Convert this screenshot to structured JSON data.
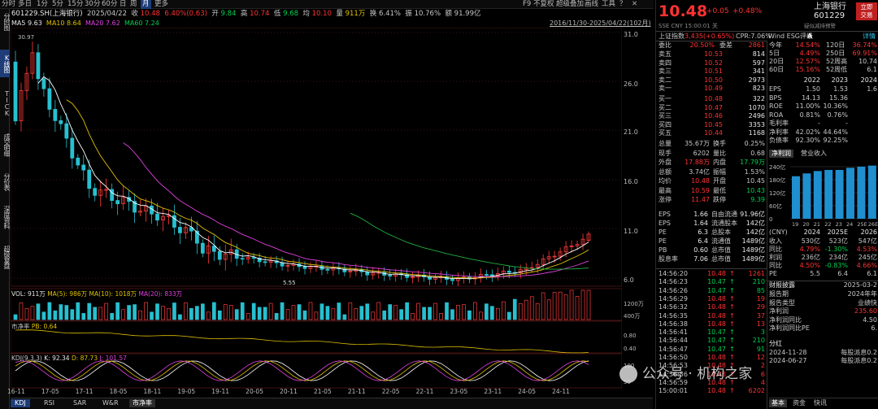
{
  "top_menu": [
    {
      "label": "分时"
    },
    {
      "label": "多日"
    },
    {
      "label": "1分"
    },
    {
      "label": "5分"
    },
    {
      "label": "15分"
    },
    {
      "label": "30分"
    },
    {
      "label": "60分"
    },
    {
      "label": "日"
    },
    {
      "label": "周"
    },
    {
      "label": "月",
      "active": true
    },
    {
      "label": "更多"
    }
  ],
  "top_right_menu": [
    "F9",
    "不复权",
    "超级叠加",
    "画线",
    "工具",
    "？"
  ],
  "side_tabs": [
    {
      "label": "分时图"
    },
    {
      "label": "K线图",
      "active": true
    },
    {
      "label": "TICK"
    },
    {
      "label": "成交明细"
    },
    {
      "label": "分价表"
    },
    {
      "label": "深度资料"
    },
    {
      "label": "超级复盘"
    }
  ],
  "quote_line": {
    "code": "601229.SH(上海银行)",
    "date": "2025/04/22",
    "close_label": "收",
    "close": "10.48",
    "chg": "6.40%(0.63)",
    "open_label": "开",
    "open": "9.84",
    "high_label": "高",
    "high": "10.74",
    "low_label": "低",
    "low": "9.68",
    "pre_label": "均",
    "pre": "10.10",
    "vol_label": "量",
    "vol": "911万",
    "turn_label": "换",
    "turn": "6.41%",
    "amp_label": "振",
    "amp": "10.76%",
    "amt_label": "额",
    "amt": "91.99亿"
  },
  "ma_line": {
    "ma5": "MA5 9.63",
    "ma10": "MA10 8.64",
    "ma20": "MA20 7.62",
    "ma60": "MA60 7.24",
    "range": "2016/11/30-2025/04/22(102月)"
  },
  "price_marks": {
    "high": "30.97",
    "low": "5.55"
  },
  "price_axis": [
    "31.0",
    "26.0",
    "21.0",
    "16.0",
    "11.0",
    "6.0"
  ],
  "vol_line": {
    "vol": "VOL: 911万",
    "ma5": "MA(5): 986万",
    "ma10": "MA(10): 1018万",
    "ma20": "MA(20): 833万"
  },
  "vol_axis": [
    "1200万",
    "400万"
  ],
  "pb_line": {
    "name": "市净率",
    "pb": "PB: 0.64"
  },
  "pb_axis": [
    "0.80",
    "0.40"
  ],
  "kdj_line": {
    "name": "KDJ(9,3,3)",
    "k": "K: 92.34",
    "d": "D: 87.73",
    "j": "J: 101.57"
  },
  "kdj_axis": [
    "100",
    "50"
  ],
  "x_axis": [
    "16-11",
    "17-05",
    "17-11",
    "18-05",
    "18-11",
    "19-05",
    "19-11",
    "20-05",
    "20-11",
    "21-05",
    "21-11",
    "22-05",
    "22-11",
    "23-05",
    "23-11",
    "24-05",
    "24-11"
  ],
  "bottom_tabs": [
    {
      "label": "KDJ",
      "active": true
    },
    {
      "label": "RSI"
    },
    {
      "label": "SAR"
    },
    {
      "label": "W&R"
    },
    {
      "label": "市净率",
      "active2": true
    }
  ],
  "chart_data": {
    "type": "candlestick",
    "title": "601229.SH(上海银行) 月K",
    "x": [
      "16-11",
      "17-05",
      "17-11",
      "18-05",
      "18-11",
      "19-05",
      "19-11",
      "20-05",
      "20-11",
      "21-05",
      "21-11",
      "22-05",
      "22-11",
      "23-05",
      "23-11",
      "24-05",
      "24-11"
    ],
    "price_range": [
      5.55,
      30.97
    ],
    "last_close": 10.48
  },
  "header": {
    "price": "10.48",
    "chg": "+0.05",
    "pct": "+0.48%",
    "name": "上海银行",
    "code": "601229",
    "badge1": "立即",
    "badge2": "交易",
    "sub": "SSE  CNY  15:00:01  关",
    "tag": "疑似减持预警",
    "shangzheng": "上证指数",
    "sz_val": "3,435(+0.65%)",
    "cpr": "CPR:7.06%",
    "wind": "Wind ESG评级",
    "rating": "A",
    "fin": "详情"
  },
  "order_book": [
    {
      "l": "委比",
      "v": "20.50%",
      "l2": "委差",
      "v2": "2861"
    },
    {
      "l": "卖五",
      "v": "10.53",
      "q": "814"
    },
    {
      "l": "卖四",
      "v": "10.52",
      "q": "597"
    },
    {
      "l": "卖三",
      "v": "10.51",
      "q": "341"
    },
    {
      "l": "卖二",
      "v": "10.50",
      "q": "2973"
    },
    {
      "l": "卖一",
      "v": "10.49",
      "q": "823"
    },
    {
      "l": "买一",
      "v": "10.48",
      "q": "322"
    },
    {
      "l": "买二",
      "v": "10.47",
      "q": "1070"
    },
    {
      "l": "买三",
      "v": "10.46",
      "q": "2496"
    },
    {
      "l": "买四",
      "v": "10.45",
      "q": "3353"
    },
    {
      "l": "买五",
      "v": "10.44",
      "q": "1168"
    }
  ],
  "stats": [
    [
      "总量",
      "35.67万",
      "换手",
      "0.25%"
    ],
    [
      "现手",
      "6202",
      "量比",
      "0.68"
    ],
    [
      "外盘",
      "17.88万",
      "内盘",
      "17.79万"
    ],
    [
      "总额",
      "3.74亿",
      "振幅",
      "1.53%"
    ],
    [
      "均价",
      "10.48",
      "开盘",
      "10.45"
    ],
    [
      "最高",
      "10.59",
      "最低",
      "10.43"
    ],
    [
      "涨停",
      "11.47",
      "跌停",
      "9.39"
    ]
  ],
  "valuation": [
    [
      "EPS",
      "1.66",
      "自由流通",
      "91.96亿"
    ],
    [
      "EPS",
      "1.64",
      "流通股本",
      "142亿"
    ],
    [
      "PE",
      "6.3",
      "总股本",
      "142亿"
    ],
    [
      "PE",
      "6.4",
      "流通值",
      "1489亿"
    ],
    [
      "PB",
      "0.60",
      "总市值",
      "1489亿"
    ],
    [
      "股息率",
      "7.06",
      "总市值",
      "1489亿"
    ]
  ],
  "ticks": [
    [
      "14:56:20",
      "10.48",
      "1261"
    ],
    [
      "14:56:23",
      "10.47",
      "210"
    ],
    [
      "14:56:26",
      "10.47",
      "85"
    ],
    [
      "14:56:29",
      "10.48",
      "19"
    ],
    [
      "14:56:32",
      "10.48",
      "29"
    ],
    [
      "14:56:35",
      "10.48",
      "37"
    ],
    [
      "14:56:38",
      "10.48",
      "13"
    ],
    [
      "14:56:41",
      "10.47",
      "3"
    ],
    [
      "14:56:44",
      "10.47",
      "210"
    ],
    [
      "14:56:47",
      "10.47",
      "91"
    ],
    [
      "14:56:50",
      "10.48",
      "12"
    ],
    [
      "14:56:53",
      "10.48",
      "2"
    ],
    [
      "14:56:56",
      "10.48",
      "6"
    ],
    [
      "14:56:59",
      "10.48",
      "4"
    ],
    [
      "15:00:01",
      "10.48",
      "6202"
    ]
  ],
  "returns": {
    "head": [
      "今年",
      "14.54%",
      "120日",
      "36.74%"
    ],
    "rows": [
      [
        "5日",
        "4.49%",
        "250日",
        "69.91%"
      ],
      [
        "20日",
        "12.57%",
        "52周高",
        "10.74"
      ],
      [
        "60日",
        "15.16%",
        "52周低",
        "6.1"
      ]
    ]
  },
  "fin_years": [
    "2022",
    "2023",
    "2024"
  ],
  "fin_rows": [
    [
      "EPS",
      "1.50",
      "1.53",
      "1.6"
    ],
    [
      "BPS",
      "14.13",
      "15.36",
      ""
    ],
    [
      "ROE",
      "11.00%",
      "10.36%",
      ""
    ],
    [
      "ROA",
      "0.81%",
      "0.76%",
      ""
    ],
    [
      "毛利率",
      "-",
      "-",
      ""
    ],
    [
      "净利率",
      "42.02%",
      "44.64%",
      ""
    ],
    [
      "负债率",
      "92.30%",
      "92.25%",
      ""
    ]
  ],
  "rev_tabs": [
    "净利润",
    "营业收入"
  ],
  "bar_axis": [
    "240亿",
    "180亿",
    "120亿",
    "60亿",
    "0"
  ],
  "bar_x": [
    "19",
    "20",
    "21",
    "22",
    "23",
    "24",
    "25E",
    "26E"
  ],
  "bar_values": [
    196,
    209,
    220,
    225,
    225,
    235,
    240,
    245
  ],
  "forecast_head": [
    "(CNY)",
    "2024",
    "2025E",
    "2026"
  ],
  "forecast": [
    [
      "收入",
      "530亿",
      "523亿",
      "547亿"
    ],
    [
      "同比",
      "4.79%",
      "-1.30%",
      "4.53%"
    ],
    [
      "利润",
      "236亿",
      "234亿",
      "245亿"
    ],
    [
      "同比",
      "4.50%",
      "-0.83%",
      "4.66%"
    ],
    [
      "PE",
      "5.5",
      "6.4",
      "6.1"
    ]
  ],
  "report": {
    "title": "财报披露",
    "date": "2025-03-2",
    "r1": "报告期",
    "v1": "2024年年",
    "r2": "报告类型",
    "v2": "业绩快",
    "r3": "净利润",
    "v3": "235.60",
    "r4": "净利润同比",
    "v4": "4.50",
    "r5": "净利润同比PE",
    "v5": "6."
  },
  "dividend": {
    "title": "分红",
    "d1": "2024-11-28",
    "t1": "每股派息0.2",
    "d2": "2024-06-27",
    "t2": "每股派息0.2"
  },
  "rp_bottom_tabs": [
    "基本",
    "资金",
    "快讯"
  ],
  "watermark": "公众号 · 机构之家"
}
